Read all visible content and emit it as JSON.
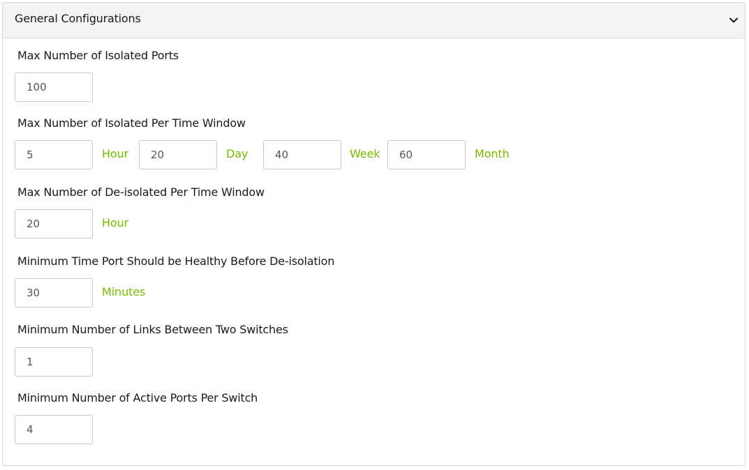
{
  "panel": {
    "title": "General Configurations"
  },
  "fields": {
    "max_isolated_ports": {
      "label": "Max Number of Isolated Ports",
      "value": "100"
    },
    "max_isolated_per_window": {
      "label": "Max Number of Isolated Per Time Window",
      "hour_value": "5",
      "hour_unit": "Hour",
      "day_value": "20",
      "day_unit": "Day",
      "week_value": "40",
      "week_unit": "Week",
      "month_value": "60",
      "month_unit": "Month"
    },
    "max_deisolated_per_window": {
      "label": "Max Number of De-isolated Per Time Window",
      "value": "20",
      "unit": "Hour"
    },
    "min_healthy_time": {
      "label": "Minimum Time Port Should be Healthy Before De-isolation",
      "value": "30",
      "unit": "Minutes"
    },
    "min_links_between_switches": {
      "label": "Minimum Number of Links Between Two Switches",
      "value": "1"
    },
    "min_active_ports_per_switch": {
      "label": "Minimum Number of Active Ports Per Switch",
      "value": "4"
    }
  },
  "colors": {
    "unit_accent": "#76b900",
    "header_bg": "#f4f4f4",
    "border": "#c8c8c8"
  },
  "icons": {
    "collapse": "chevron-down-icon"
  }
}
